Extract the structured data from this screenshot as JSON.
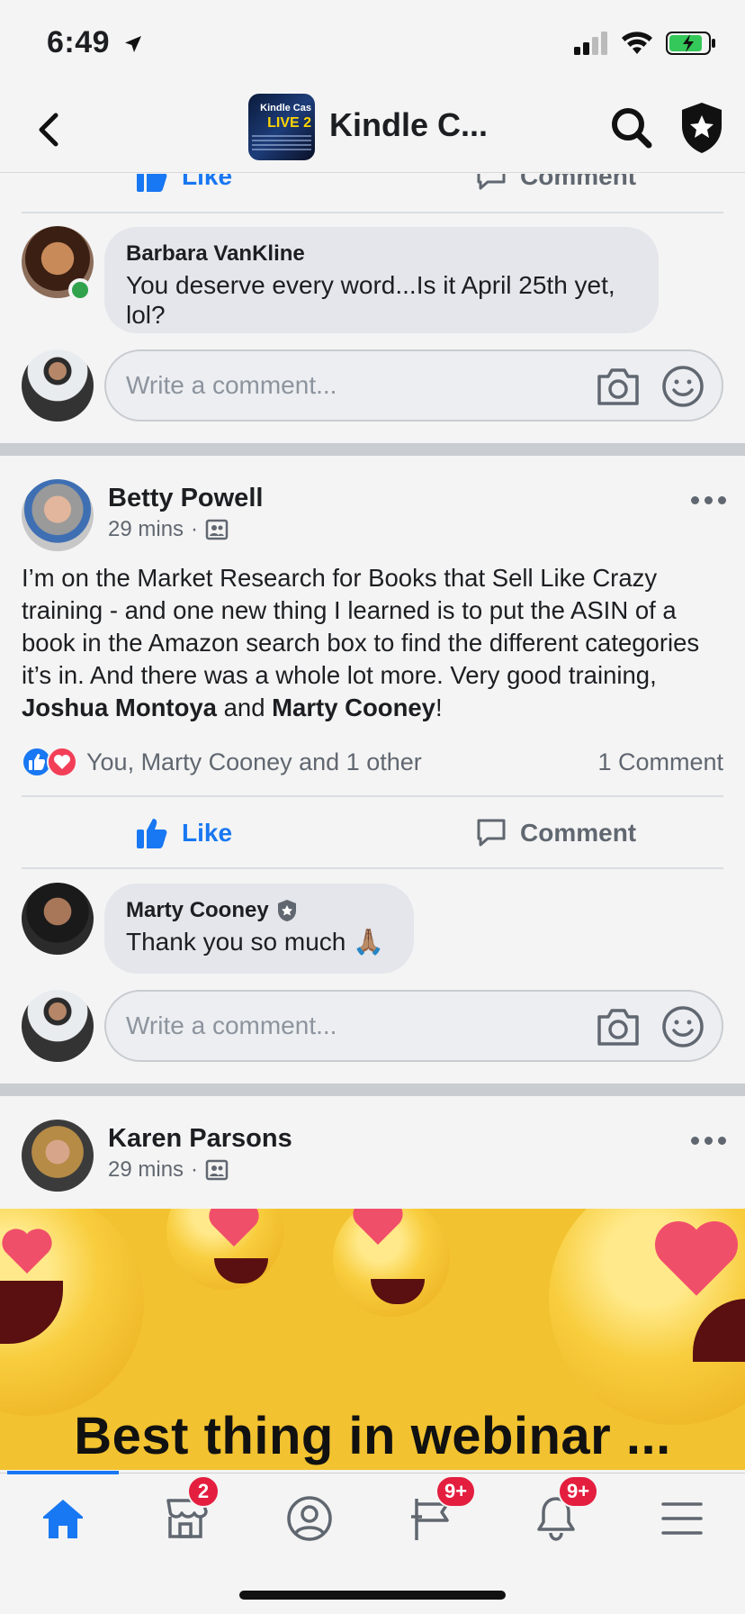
{
  "status": {
    "time": "6:49"
  },
  "header": {
    "title": "Kindle C...",
    "thumb_line1": "Kindle Cas",
    "thumb_line2": "LIVE 2"
  },
  "top_actions": {
    "like": "Like",
    "comment": "Comment"
  },
  "comment1": {
    "author": "Barbara VanKline",
    "text": "You deserve every word...Is it April 25th yet, lol?"
  },
  "write_comment": {
    "placeholder": "Write a comment..."
  },
  "post1": {
    "author": "Betty Powell",
    "time": "29 mins",
    "body_1": "I’m on the Market Research for Books that Sell Like Crazy training - and one new thing I learned is to put the ASIN of a book in the Amazon search box to find the different categories it’s in.  And there was a whole lot more.  Very good training, ",
    "mention_1": "Joshua Montoya",
    "body_and": " and ",
    "mention_2": "Marty Cooney",
    "body_end": "!",
    "reactions_text": "You, Marty Cooney and 1 other",
    "comments_count": "1 Comment",
    "like_label": "Like",
    "comment_label": "Comment"
  },
  "comment2": {
    "author": "Marty Cooney",
    "text": "Thank you so much",
    "emoji": "🙏🏽"
  },
  "post2": {
    "author": "Karen Parsons",
    "time": "29 mins",
    "image_caption": "Best thing in webinar ..."
  },
  "tabs": {
    "marketplace_badge": "2",
    "groups_badge": "9+",
    "notifications_badge": "9+"
  },
  "colors": {
    "accent": "#1877f2",
    "badge": "#e41e3f",
    "online": "#31a24c"
  }
}
